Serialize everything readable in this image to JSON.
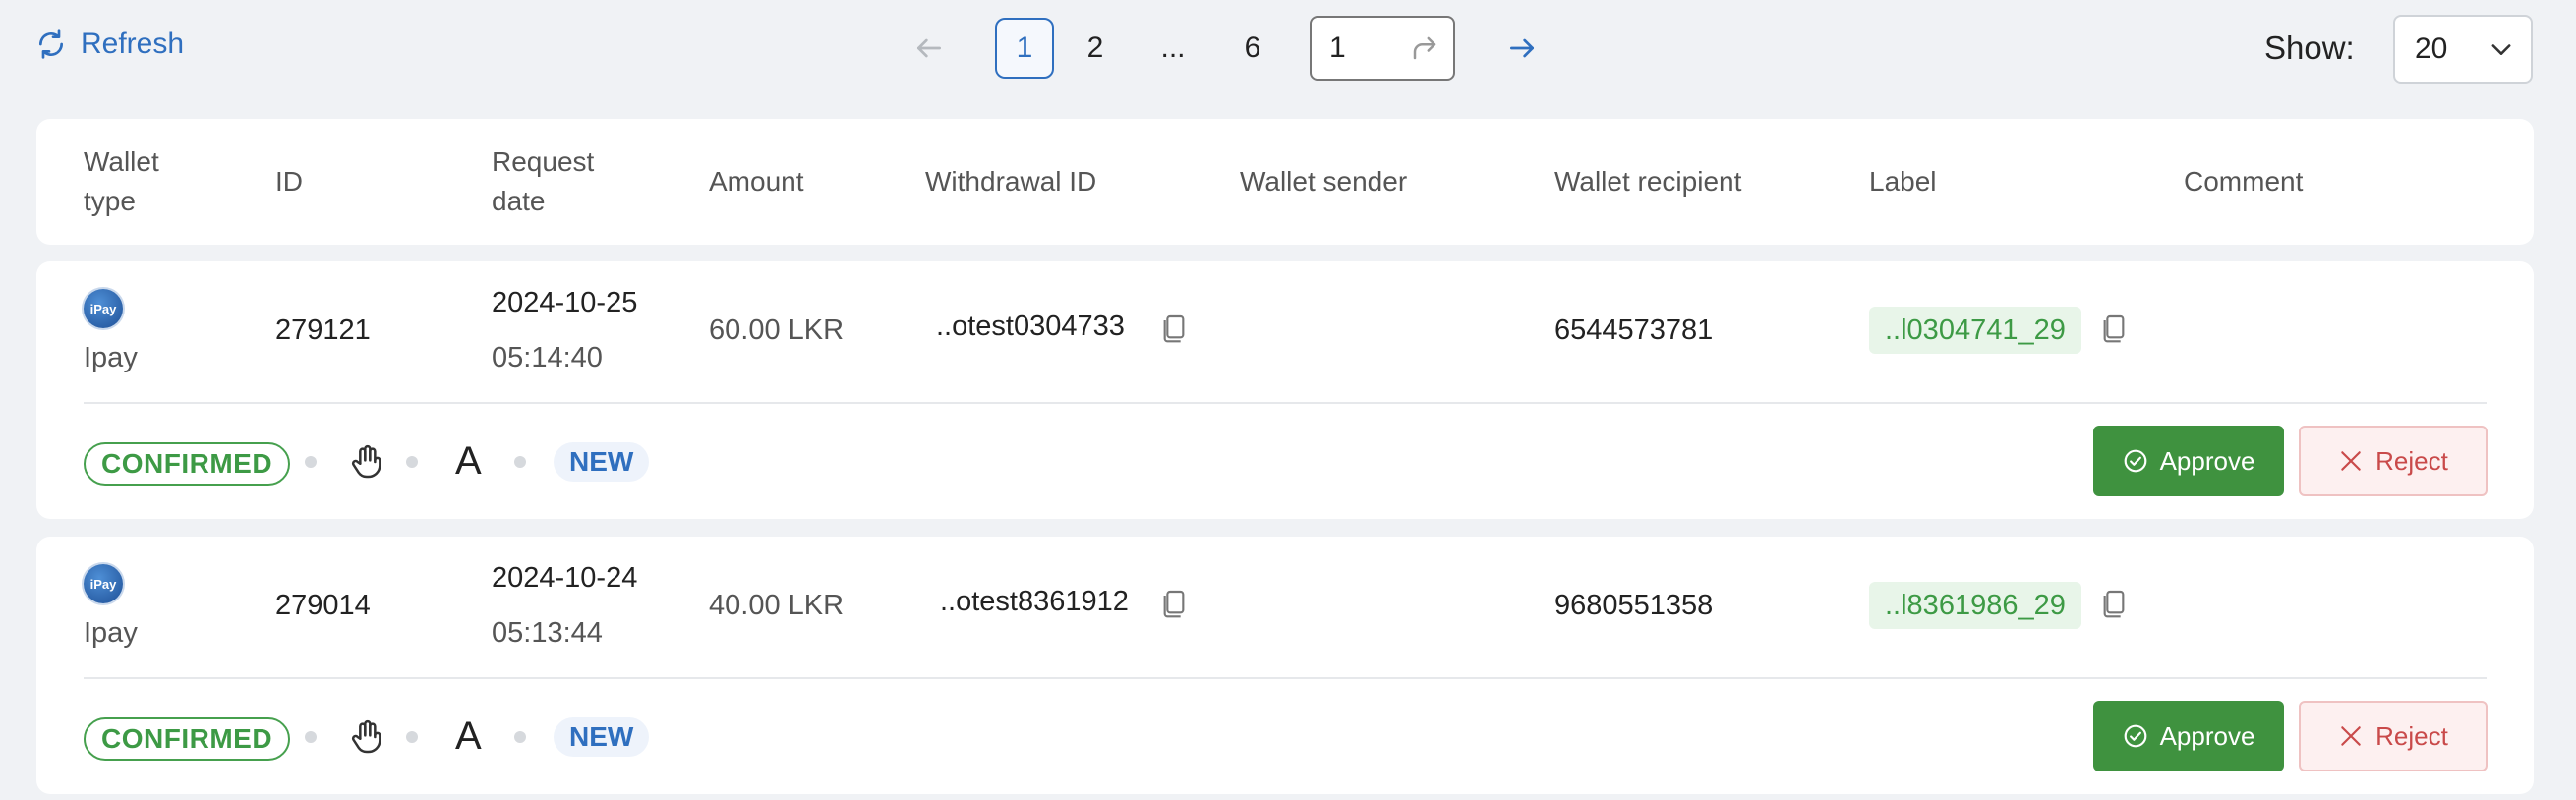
{
  "toolbar": {
    "refresh_label": "Refresh",
    "show_label": "Show:",
    "page_size": "20"
  },
  "pagination": {
    "pages": [
      "1",
      "2",
      "...",
      "6"
    ],
    "current_page": "1",
    "jump_value": "1"
  },
  "table": {
    "columns": [
      "Wallet\ntype",
      "ID",
      "Request\ndate",
      "Amount",
      "Withdrawal ID",
      "Wallet sender",
      "Wallet recipient",
      "Label",
      "Comment"
    ],
    "rows": [
      {
        "wallet_logo_text": "iPay",
        "wallet_type": "Ipay",
        "id": "279121",
        "request_date": "2024-10-25",
        "request_time": "05:14:40",
        "amount": "60.00 LKR",
        "withdrawal_id": "..otest0304733",
        "wallet_sender": "",
        "wallet_recipient": "6544573781",
        "label": "..l0304741_29",
        "comment": "",
        "status": "CONFIRMED",
        "method_letter": "A",
        "badge": "NEW",
        "approve_label": "Approve",
        "reject_label": "Reject"
      },
      {
        "wallet_logo_text": "iPay",
        "wallet_type": "Ipay",
        "id": "279014",
        "request_date": "2024-10-24",
        "request_time": "05:13:44",
        "amount": "40.00 LKR",
        "withdrawal_id": "..otest8361912",
        "wallet_sender": "",
        "wallet_recipient": "9680551358",
        "label": "..l8361986_29",
        "comment": "",
        "status": "CONFIRMED",
        "method_letter": "A",
        "badge": "NEW",
        "approve_label": "Approve",
        "reject_label": "Reject"
      }
    ]
  },
  "colors": {
    "accent": "#2f6fbf",
    "success": "#3f923f",
    "danger": "#c94a4a",
    "background": "#f0f2f5"
  },
  "icons": [
    "refresh-icon",
    "arrow-left-icon",
    "arrow-right-icon",
    "redo-arrow-icon",
    "chevron-down-icon",
    "copy-icon",
    "hand-icon",
    "check-circle-icon",
    "close-icon"
  ]
}
